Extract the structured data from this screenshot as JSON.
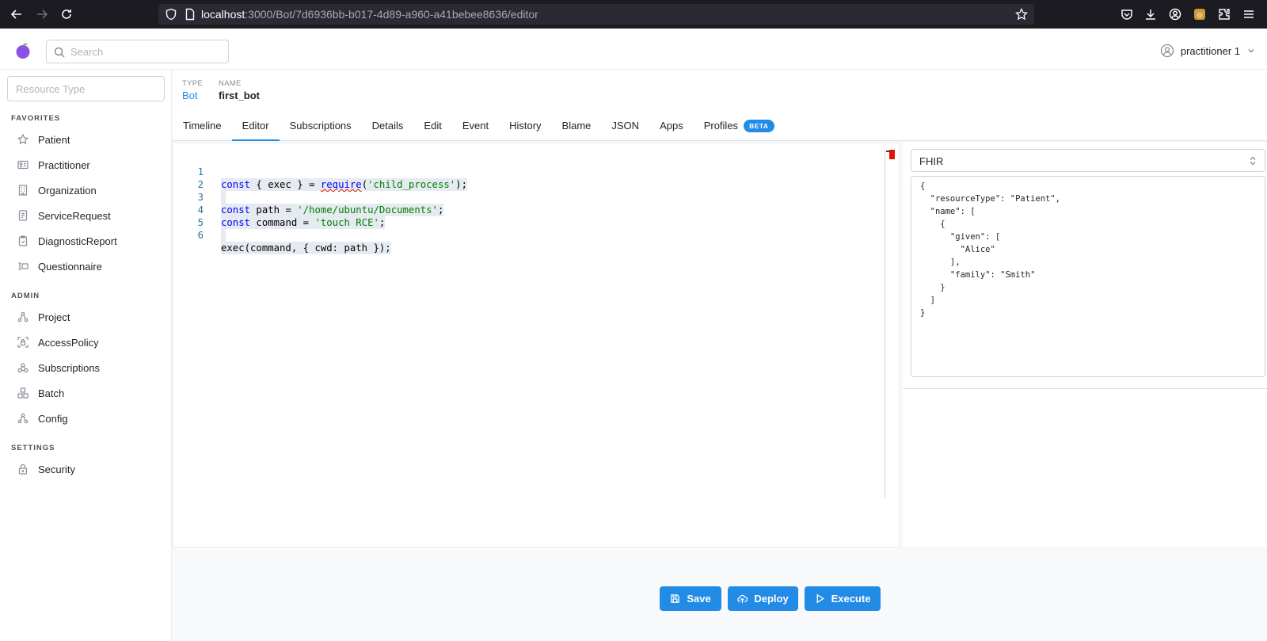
{
  "browser": {
    "url_host": "localhost",
    "url_rest": ":3000/Bot/7d6936bb-b017-4d89-a960-a41bebee8636/editor"
  },
  "header": {
    "search_placeholder": "Search",
    "user_name": "practitioner 1"
  },
  "sidebar": {
    "resource_type_placeholder": "Resource Type",
    "favorites_title": "FAVORITES",
    "favorites": [
      {
        "label": "Patient",
        "icon": "star-icon"
      },
      {
        "label": "Practitioner",
        "icon": "id-card-icon"
      },
      {
        "label": "Organization",
        "icon": "building-icon"
      },
      {
        "label": "ServiceRequest",
        "icon": "file-icon"
      },
      {
        "label": "DiagnosticReport",
        "icon": "clipboard-icon"
      },
      {
        "label": "Questionnaire",
        "icon": "form-icon"
      }
    ],
    "admin_title": "ADMIN",
    "admin": [
      {
        "label": "Project",
        "icon": "hierarchy-icon"
      },
      {
        "label": "AccessPolicy",
        "icon": "lock-scan-icon"
      },
      {
        "label": "Subscriptions",
        "icon": "webhook-icon"
      },
      {
        "label": "Batch",
        "icon": "packages-icon"
      },
      {
        "label": "Config",
        "icon": "hierarchy-icon"
      }
    ],
    "settings_title": "SETTINGS",
    "settings": [
      {
        "label": "Security",
        "icon": "lock-icon"
      }
    ]
  },
  "resource": {
    "type_label": "TYPE",
    "type_value": "Bot",
    "name_label": "NAME",
    "name_value": "first_bot"
  },
  "tabs": [
    {
      "label": "Timeline"
    },
    {
      "label": "Editor",
      "active": true
    },
    {
      "label": "Subscriptions"
    },
    {
      "label": "Details"
    },
    {
      "label": "Edit"
    },
    {
      "label": "Event"
    },
    {
      "label": "History"
    },
    {
      "label": "Blame"
    },
    {
      "label": "JSON"
    },
    {
      "label": "Apps"
    },
    {
      "label": "Profiles"
    }
  ],
  "beta_badge": "BETA",
  "code": {
    "line_numbers": [
      "1",
      "2",
      "3",
      "4",
      "5",
      "6"
    ],
    "lines": [
      "const { exec } = require('child_process');",
      "",
      "const path = '/home/ubuntu/Documents';",
      "const command = 'touch RCE';",
      "",
      "exec(command, { cwd: path });"
    ]
  },
  "buttons": {
    "save": "Save",
    "deploy": "Deploy",
    "execute": "Execute"
  },
  "input_panel": {
    "format": "FHIR",
    "json_lines": [
      "{",
      "  \"resourceType\": \"Patient\",",
      "  \"name\": [",
      "    {",
      "      \"given\": [",
      "        \"Alice\"",
      "      ],",
      "      \"family\": \"Smith\"",
      "    }",
      "  ]",
      "}"
    ]
  },
  "colors": {
    "accent": "#228be6",
    "browser_bg": "#1c1b22"
  }
}
